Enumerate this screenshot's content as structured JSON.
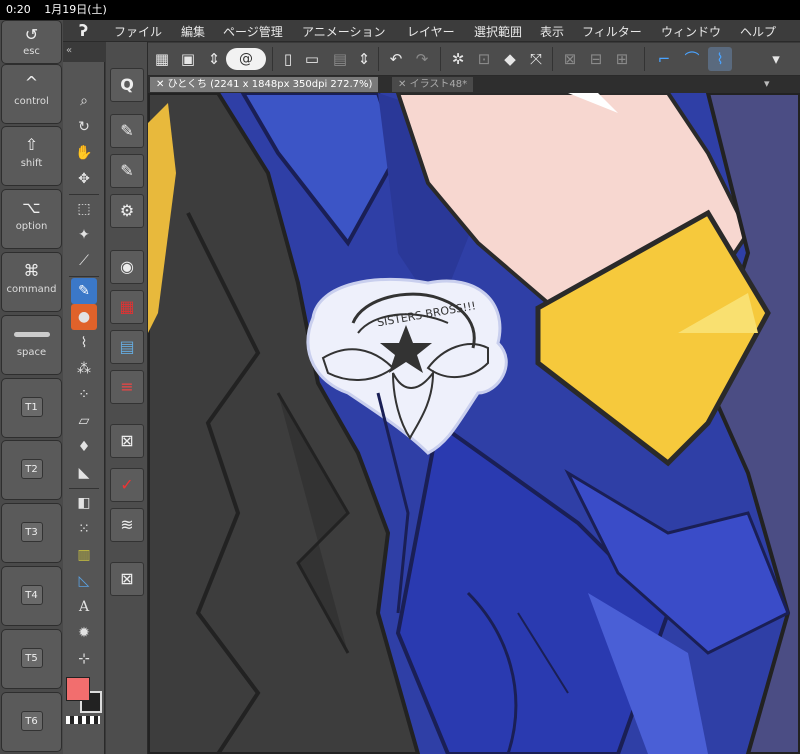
{
  "status_bar": {
    "time": "0:20",
    "date": "1月19日(土)"
  },
  "shortcut_keys": [
    {
      "label": "esc",
      "glyph": "↺"
    },
    {
      "label": "control",
      "glyph": "^"
    },
    {
      "label": "shift",
      "glyph": "⇧"
    },
    {
      "label": "option",
      "glyph": "⌥"
    },
    {
      "label": "command",
      "glyph": "⌘"
    },
    {
      "label": "space",
      "glyph": ""
    },
    {
      "label": "T1"
    },
    {
      "label": "T2"
    },
    {
      "label": "T3"
    },
    {
      "label": "T4"
    },
    {
      "label": "T5"
    },
    {
      "label": "T6"
    }
  ],
  "menu": [
    "ファイル",
    "編集",
    "ページ管理",
    "アニメーション",
    "レイヤー",
    "選択範囲",
    "表示",
    "フィルター",
    "ウィンドウ",
    "ヘルプ"
  ],
  "tabs": [
    {
      "label": "ひとくち (2241 x 1848px 350dpi 272.7%)",
      "close": "✕"
    },
    {
      "label": "イラスト48*",
      "close": "✕"
    }
  ],
  "canvas": {
    "emblem_text": "SISTERS BROSS!!!"
  },
  "colors": {
    "foreground": "#f26e6e",
    "background": "#222222",
    "active_tool": "#3b78c8",
    "coat_blue": "#2f3a8c",
    "cuff_yellow": "#f6c93c"
  },
  "icons": {
    "tools": [
      "zoom-icon",
      "rotate-icon",
      "hand-icon",
      "move-icon",
      "selection-icon",
      "magic-wand-icon",
      "eyedropper-icon",
      "pen-icon",
      "ink-icon",
      "brush-icon",
      "airbrush-icon",
      "decoration-icon",
      "eraser-icon",
      "blend-icon",
      "fill-icon",
      "gradient-icon",
      "figure-icon",
      "frame-icon",
      "ruler-icon",
      "text-icon",
      "balloon-icon",
      "correction-icon"
    ],
    "palettes": [
      "quick-access-icon",
      "sub-tool-icon",
      "sub-tool-view-icon",
      "tool-property-icon",
      "color-wheel-icon",
      "color-set-icon",
      "timeline-icon",
      "color-slider-icon",
      "material-icon",
      "layer-property-icon",
      "layer-icon",
      "material-2-icon"
    ]
  }
}
